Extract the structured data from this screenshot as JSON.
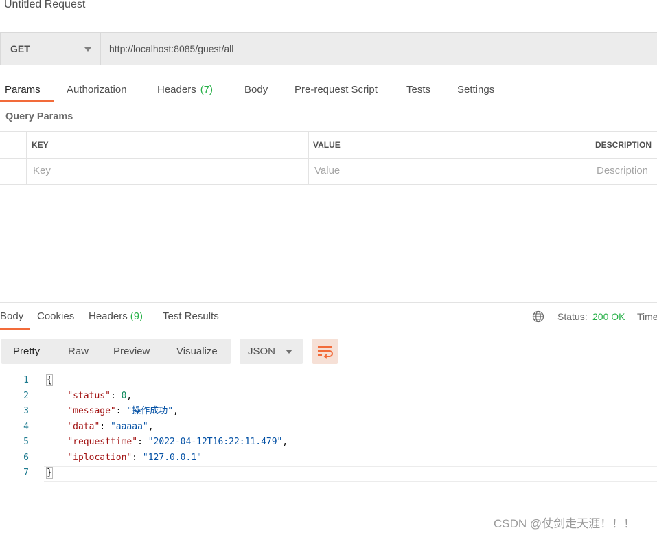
{
  "request": {
    "title": "Untitled Request",
    "method": "GET",
    "url": "http://localhost:8085/guest/all"
  },
  "request_tabs": [
    {
      "label": "Params",
      "count": ""
    },
    {
      "label": "Authorization",
      "count": ""
    },
    {
      "label": "Headers",
      "count": "(7)"
    },
    {
      "label": "Body",
      "count": ""
    },
    {
      "label": "Pre-request Script",
      "count": ""
    },
    {
      "label": "Tests",
      "count": ""
    },
    {
      "label": "Settings",
      "count": ""
    }
  ],
  "query_params": {
    "title": "Query Params",
    "columns": [
      "KEY",
      "VALUE",
      "DESCRIPTION"
    ],
    "placeholders": [
      "Key",
      "Value",
      "Description"
    ]
  },
  "response": {
    "tabs": [
      {
        "label": "Body",
        "count": ""
      },
      {
        "label": "Cookies",
        "count": ""
      },
      {
        "label": "Headers",
        "count": "(9)"
      },
      {
        "label": "Test Results",
        "count": ""
      }
    ],
    "status_label": "Status:",
    "status_value": "200 OK",
    "time_label": "Time",
    "view_modes": [
      "Pretty",
      "Raw",
      "Preview",
      "Visualize"
    ],
    "format": "JSON",
    "line_numbers": [
      "1",
      "2",
      "3",
      "4",
      "5",
      "6",
      "7"
    ],
    "body": {
      "open": "{",
      "close": "}",
      "entries": [
        {
          "key": "\"status\"",
          "value": "0",
          "trail": ","
        },
        {
          "key": "\"message\"",
          "value": "\"操作成功\"",
          "trail": ","
        },
        {
          "key": "\"data\"",
          "value": "\"aaaaa\"",
          "trail": ","
        },
        {
          "key": "\"requesttime\"",
          "value": "\"2022-04-12T16:22:11.479\"",
          "trail": ","
        },
        {
          "key": "\"iplocation\"",
          "value": "\"127.0.0.1\"",
          "trail": ""
        }
      ]
    }
  },
  "watermark": "CSDN @仗剑走天涯！！！",
  "icons": {
    "method_dropdown": "chevron-down-icon",
    "format_dropdown": "chevron-down-icon",
    "wrap": "wrap-lines-icon",
    "network": "globe-icon"
  },
  "colors": {
    "accent": "#f26b3a",
    "success": "#26b047",
    "json_key": "#a31515",
    "json_string": "#0451a5",
    "json_number": "#098658"
  }
}
